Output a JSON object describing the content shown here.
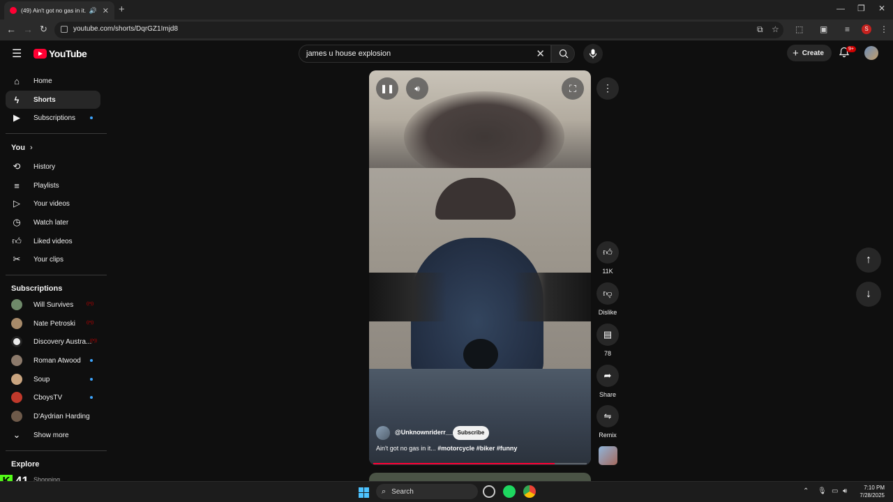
{
  "browser": {
    "tab_title": "(49) Ain't got no gas in it...",
    "url": "youtube.com/shorts/DqrGZ1Imjd8",
    "profile_letter": "S"
  },
  "header": {
    "logo_text": "YouTube",
    "search_query": "james u house explosion",
    "create_label": "Create",
    "notification_badge": "9+"
  },
  "sidebar": {
    "main": [
      {
        "label": "Home",
        "icon": "home-icon"
      },
      {
        "label": "Shorts",
        "icon": "shorts-icon"
      },
      {
        "label": "Subscriptions",
        "icon": "subscriptions-icon"
      }
    ],
    "you_heading": "You",
    "you_items": [
      {
        "label": "History"
      },
      {
        "label": "Playlists"
      },
      {
        "label": "Your videos"
      },
      {
        "label": "Watch later"
      },
      {
        "label": "Liked videos"
      },
      {
        "label": "Your clips"
      }
    ],
    "subscriptions_heading": "Subscriptions",
    "subscriptions": [
      {
        "label": "Will Survives",
        "status": "live",
        "color": "#6f8a6a"
      },
      {
        "label": "Nate Petroski",
        "status": "live",
        "color": "#a78a6a"
      },
      {
        "label": "Discovery Austra...",
        "status": "live",
        "color": "#e9e9e9"
      },
      {
        "label": "Roman Atwood",
        "status": "new",
        "color": "#8c7a6b"
      },
      {
        "label": "Soup",
        "status": "new",
        "color": "#c9a47f"
      },
      {
        "label": "CboysTV",
        "status": "new",
        "color": "#c0392b"
      },
      {
        "label": "D'Aydrian Harding",
        "status": "none",
        "color": "#6e5a4a"
      }
    ],
    "show_more": "Show more",
    "explore_heading": "Explore",
    "explore_peek": "Shopping"
  },
  "short": {
    "channel": "@Unknownriderr__",
    "subscribe_label": "Subscribe",
    "title_plain": "Ain't got no gas in it... ",
    "title_tags": "#motorcycle #biker #funny",
    "progress": 0.85
  },
  "actions": {
    "likes": "11K",
    "dislike_label": "Dislike",
    "comments": "78",
    "share_label": "Share",
    "remix_label": "Remix"
  },
  "taskbar": {
    "search_label": "Search",
    "time": "7:10 PM",
    "date": "7/28/2025"
  },
  "overlay": {
    "stock_value": "41"
  },
  "colors": {
    "accent": "#ff0033",
    "blue_dot": "#3ea6ff",
    "background": "#0f0f0f"
  }
}
